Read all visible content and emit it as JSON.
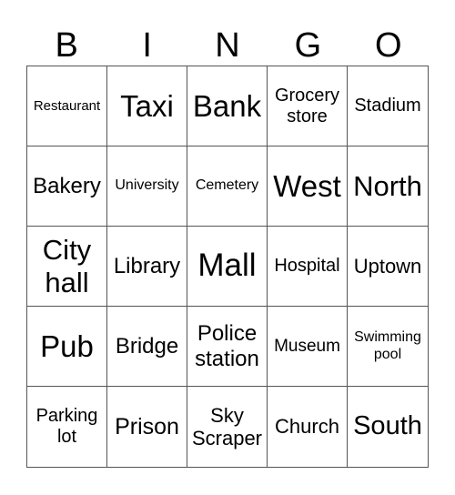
{
  "header": {
    "letters": [
      "B",
      "I",
      "N",
      "G",
      "O"
    ]
  },
  "cells": [
    {
      "text": "Restaurant",
      "size": 15
    },
    {
      "text": "Taxi",
      "size": 33
    },
    {
      "text": "Bank",
      "size": 33
    },
    {
      "text": "Grocery store",
      "size": 20
    },
    {
      "text": "Stadium",
      "size": 20
    },
    {
      "text": "Bakery",
      "size": 24
    },
    {
      "text": "University",
      "size": 16
    },
    {
      "text": "Cemetery",
      "size": 16
    },
    {
      "text": "West",
      "size": 33
    },
    {
      "text": "North",
      "size": 31
    },
    {
      "text": "City hall",
      "size": 31
    },
    {
      "text": "Library",
      "size": 24
    },
    {
      "text": "Mall",
      "size": 35
    },
    {
      "text": "Hospital",
      "size": 20
    },
    {
      "text": "Uptown",
      "size": 22
    },
    {
      "text": "Pub",
      "size": 33
    },
    {
      "text": "Bridge",
      "size": 24
    },
    {
      "text": "Police station",
      "size": 24
    },
    {
      "text": "Museum",
      "size": 19
    },
    {
      "text": "Swimming pool",
      "size": 16
    },
    {
      "text": "Parking lot",
      "size": 20
    },
    {
      "text": "Prison",
      "size": 25
    },
    {
      "text": "Sky Scraper",
      "size": 22
    },
    {
      "text": "Church",
      "size": 22
    },
    {
      "text": "South",
      "size": 29
    }
  ]
}
